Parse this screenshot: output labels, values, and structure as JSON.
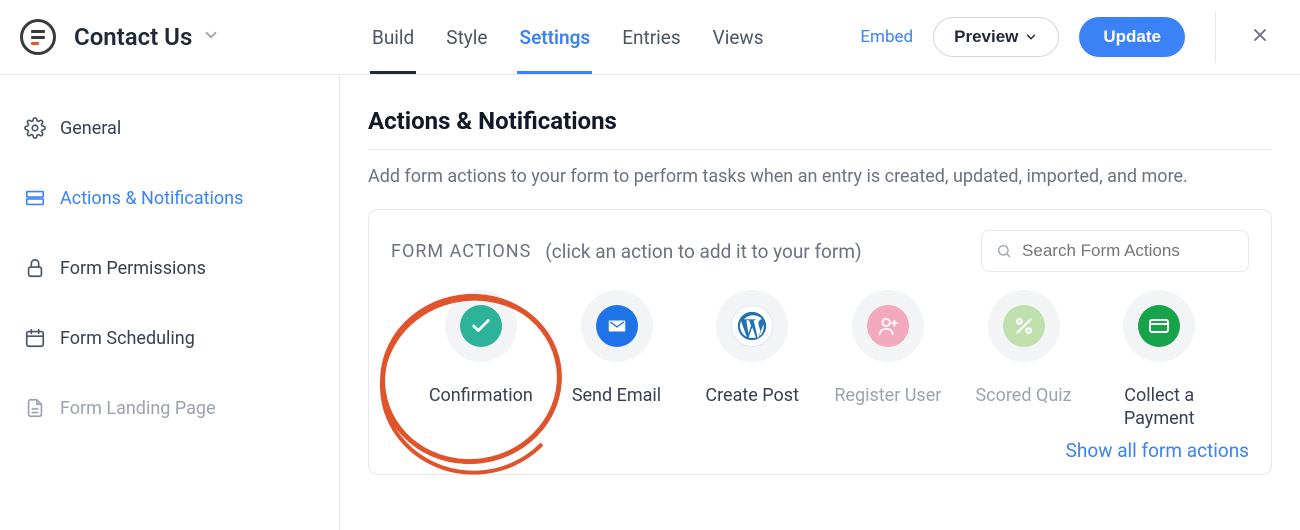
{
  "header": {
    "form_title": "Contact Us",
    "tabs": {
      "build": "Build",
      "style": "Style",
      "settings": "Settings",
      "entries": "Entries",
      "views": "Views"
    },
    "embed": "Embed",
    "preview": "Preview",
    "update": "Update"
  },
  "sidebar": {
    "general": "General",
    "actions": "Actions & Notifications",
    "permissions": "Form Permissions",
    "scheduling": "Form Scheduling",
    "landing": "Form Landing Page"
  },
  "main": {
    "title": "Actions & Notifications",
    "desc": "Add form actions to your form to perform tasks when an entry is created, updated, imported, and more.",
    "form_actions_label": "FORM ACTIONS",
    "form_actions_hint": "(click an action to add it to your form)",
    "search_placeholder": "Search Form Actions",
    "show_all": "Show all form actions"
  },
  "actions": {
    "confirmation": "Confirmation",
    "send_email": "Send Email",
    "create_post": "Create Post",
    "register_user": "Register User",
    "scored_quiz": "Scored Quiz",
    "collect_payment": "Collect a Payment"
  }
}
